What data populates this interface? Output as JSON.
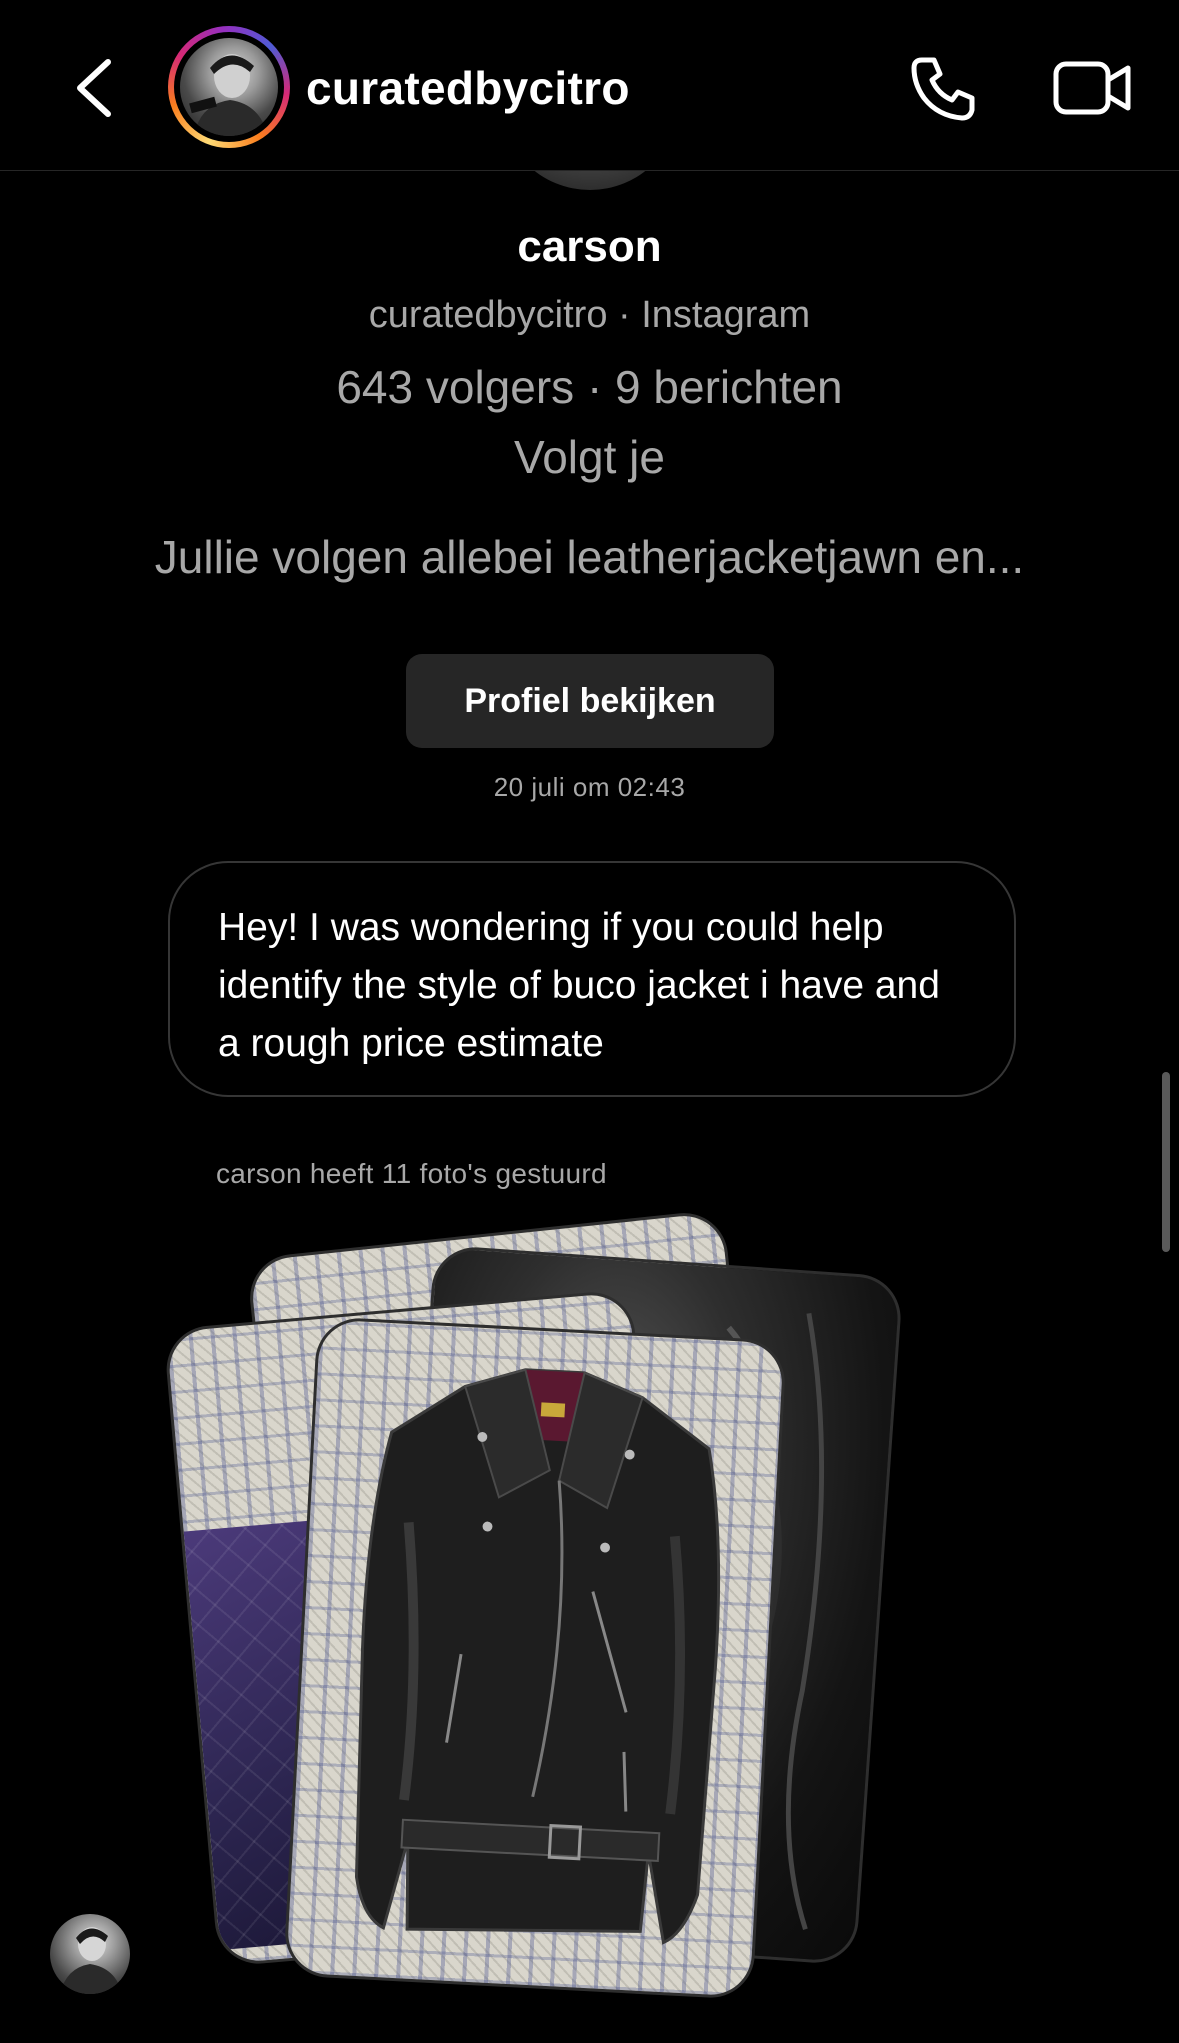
{
  "header": {
    "title": "curatedbycitro",
    "back_icon": "chevron-left-icon",
    "call_icon": "phone-icon",
    "video_icon": "video-camera-icon"
  },
  "profile": {
    "name": "carson",
    "subtitle": "curatedbycitro · Instagram",
    "stats": "643 volgers · 9 berichten",
    "follows_you": "Volgt je",
    "mutual": "Jullie volgen allebei leatherjacketjawn en...",
    "view_profile_label": "Profiel bekijken"
  },
  "conversation": {
    "timestamp": "20 juli om 02:43",
    "message_text": "Hey! I was wondering if you could help identify the style of buco jacket i have and a rough price estimate",
    "photos_caption": "carson heeft 11 foto's gestuurd",
    "photo_count": 11
  },
  "colors": {
    "background": "#000000",
    "secondary_text": "#a8a8a8",
    "button_bg": "#262626",
    "bubble_border": "#363636"
  }
}
